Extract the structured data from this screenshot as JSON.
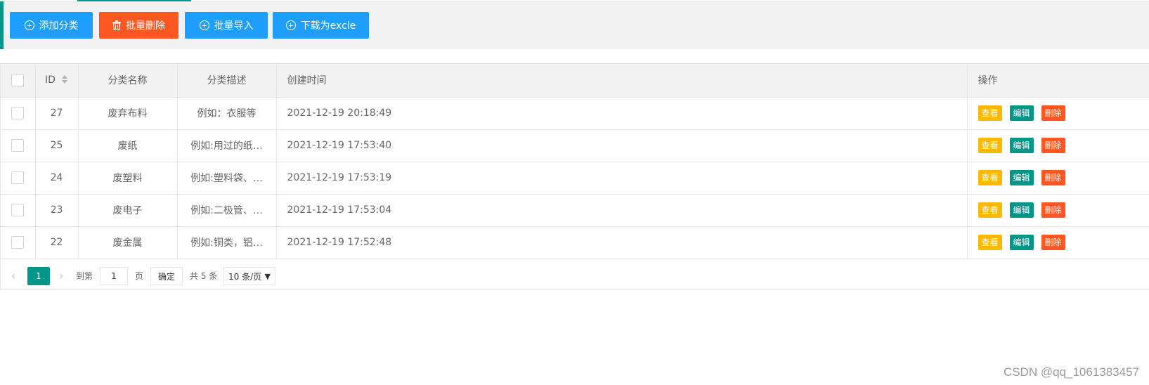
{
  "toolbar": {
    "add_label": "添加分类",
    "batch_delete_label": "批量删除",
    "batch_import_label": "批量导入",
    "export_label": "下载为excle"
  },
  "table": {
    "headers": {
      "id": "ID",
      "name": "分类名称",
      "desc": "分类描述",
      "created": "创建时间",
      "ops": "操作"
    },
    "rows": [
      {
        "id": "27",
        "name": "废弃布料",
        "desc": "例如：衣服等",
        "created": "2021-12-19 20:18:49"
      },
      {
        "id": "25",
        "name": "废纸",
        "desc": "例如:用过的纸…",
        "created": "2021-12-19 17:53:40"
      },
      {
        "id": "24",
        "name": "废塑料",
        "desc": "例如:塑料袋、…",
        "created": "2021-12-19 17:53:19"
      },
      {
        "id": "23",
        "name": "废电子",
        "desc": "例如:二极管、…",
        "created": "2021-12-19 17:53:04"
      },
      {
        "id": "22",
        "name": "废金属",
        "desc": "例如:铜类，铝…",
        "created": "2021-12-19 17:52:48"
      }
    ],
    "actions": {
      "view": "查看",
      "edit": "编辑",
      "delete": "删除"
    }
  },
  "pagination": {
    "prev_icon": "‹",
    "current_page": "1",
    "next_icon": "›",
    "goto_label": "到第",
    "goto_value": "1",
    "page_label": "页",
    "confirm_label": "确定",
    "total_label": "共 5 条",
    "page_size": "10 条/页"
  },
  "watermark": "CSDN @qq_1061383457",
  "colors": {
    "accent": "#009688",
    "blue": "#1e9fff",
    "red": "#ff5722",
    "yellow": "#ffb800"
  }
}
